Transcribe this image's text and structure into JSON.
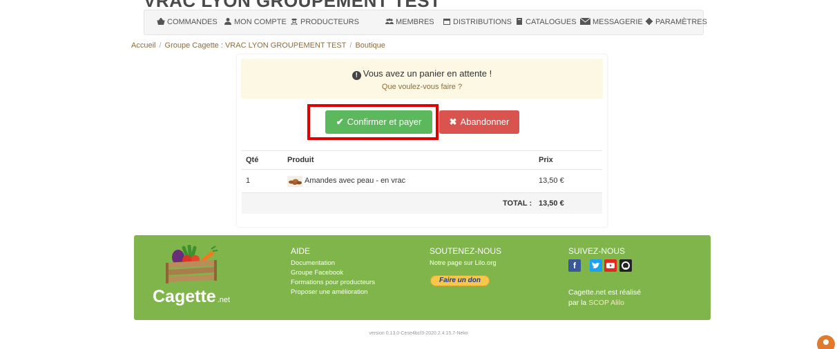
{
  "page_title_cut": "VRAC LYON GROUPEMENT TEST",
  "nav": {
    "items": [
      {
        "label": "COMMANDES",
        "icon": "basket-icon"
      },
      {
        "label": "MON COMPTE",
        "icon": "user-icon"
      },
      {
        "label": "PRODUCTEURS",
        "icon": "farmer-icon"
      },
      {
        "label": "MEMBRES",
        "icon": "users-icon"
      },
      {
        "label": "DISTRIBUTIONS",
        "icon": "calendar-icon"
      },
      {
        "label": "CATALOGUES",
        "icon": "book-icon"
      },
      {
        "label": "MESSAGERIE",
        "icon": "envelope-icon"
      },
      {
        "label": "PARAMÈTRES",
        "icon": "gear-icon"
      }
    ]
  },
  "breadcrumb": {
    "home": "Accueil",
    "group": "Groupe Cagette : VRAC LYON GROUPEMENT TEST",
    "current": "Boutique"
  },
  "alert": {
    "title": "Vous avez un panier en attente !",
    "subtitle": "Que voulez-vous faire ?"
  },
  "actions": {
    "confirm_label": "Confirmer et payer",
    "abandon_label": "Abandonner"
  },
  "cart": {
    "columns": {
      "qty": "Qté",
      "product": "Produit",
      "price": "Prix"
    },
    "rows": [
      {
        "qty": "1",
        "product": "Amandes avec peau - en vrac",
        "price": "13,50 €"
      }
    ],
    "total_label": "TOTAL :",
    "total_value": "13,50 €"
  },
  "footer": {
    "logo": {
      "name": "Cagette",
      "suffix": ".net"
    },
    "aide": {
      "title": "AIDE",
      "links": [
        "Documentation",
        "Groupe Facebook",
        "Formations pour producteurs",
        "Proposer une amélioration"
      ]
    },
    "soutenez": {
      "title": "SOUTENEZ-NOUS",
      "link": "Notre page sur Lilo.org",
      "donate_label": "Faire un don"
    },
    "suivez": {
      "title": "SUIVEZ-NOUS",
      "credit_line1": "Cagette.net est réalisé",
      "credit_line2_prefix": "par la",
      "credit_link": "SCOP Alilo"
    }
  },
  "version": "version 0.13.0-Cese4bcf3-2020.2.4.15.7-Neko",
  "colors": {
    "green_button": "#5cb85c",
    "red_button": "#d9534f",
    "footer_green": "#7fb54a",
    "alert_bg": "#fcf8e3",
    "highlight_red": "#e00000"
  }
}
